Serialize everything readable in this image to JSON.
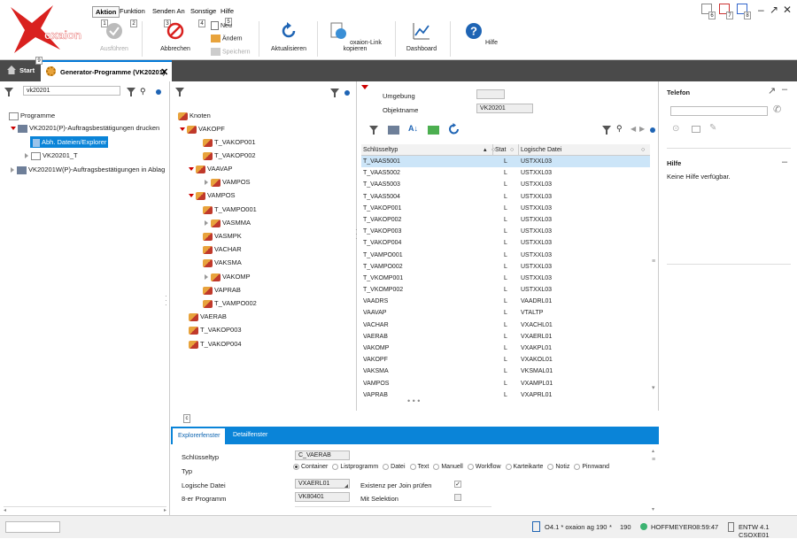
{
  "menu": {
    "items": [
      "Aktion",
      "Funktion",
      "Senden An",
      "Sonstige",
      "Hilfe"
    ],
    "shortcut_keys": [
      "1",
      "2",
      "3",
      "4",
      "5",
      "6",
      "7",
      "8",
      "9"
    ]
  },
  "brand": {
    "logo_text": "oxaion",
    "accent": "#d9211f"
  },
  "ribbon": {
    "execute": "Ausführen",
    "cancel": "Abbrechen",
    "new": "Neu",
    "change": "Ändern",
    "save": "Speichern",
    "refresh": "Aktualisieren",
    "copy_link": "oxaion-Link kopieren",
    "dashboard": "Dashboard",
    "help": "Hilfe"
  },
  "tabs": {
    "start": "Start",
    "current": "Generator-Programme (VK20201)"
  },
  "left": {
    "search_value": "vk20201",
    "root": "Programme",
    "items": [
      "VK20201(P)-Auftragsbestätigungen drucken",
      "Abh. Dateien/Explorer",
      "VK20201_T",
      "VK20201W(P)-Auftragsbestätigungen in Ablag"
    ]
  },
  "tree": {
    "root": "Knoten",
    "nodes": [
      "VAKOPF",
      "T_VAKOP001",
      "T_VAKOP002",
      "VAAVAP",
      "VAMPOS",
      "VAMPOS",
      "T_VAMPO001",
      "VASMMA",
      "VASMPK",
      "VACHAR",
      "VAKSMA",
      "VAKOMP",
      "VAPRAB",
      "T_VAMPO002",
      "VAERAB",
      "T_VAKOP003",
      "T_VAKOP004"
    ]
  },
  "env": {
    "umgebung_label": "Umgebung",
    "umgebung_value": "",
    "objektname_label": "Objektname",
    "objektname_value": "VK20201"
  },
  "grid": {
    "headers": [
      "Schlüsseltyp",
      "Stat",
      "Logische Datei"
    ],
    "rows": [
      [
        "T_VAAS5001",
        "L",
        "USTXXL03"
      ],
      [
        "T_VAAS5002",
        "L",
        "USTXXL03"
      ],
      [
        "T_VAAS5003",
        "L",
        "USTXXL03"
      ],
      [
        "T_VAAS5004",
        "L",
        "USTXXL03"
      ],
      [
        "T_VAKOP001",
        "L",
        "USTXXL03"
      ],
      [
        "T_VAKOP002",
        "L",
        "USTXXL03"
      ],
      [
        "T_VAKOP003",
        "L",
        "USTXXL03"
      ],
      [
        "T_VAKOP004",
        "L",
        "USTXXL03"
      ],
      [
        "T_VAMPO001",
        "L",
        "USTXXL03"
      ],
      [
        "T_VAMPO002",
        "L",
        "USTXXL03"
      ],
      [
        "T_VKOMP001",
        "L",
        "USTXXL03"
      ],
      [
        "T_VKOMP002",
        "L",
        "USTXXL03"
      ],
      [
        "VAADRS",
        "L",
        "VAADRL01"
      ],
      [
        "VAAVAP",
        "L",
        "VTALTP"
      ],
      [
        "VACHAR",
        "L",
        "VXACHL01"
      ],
      [
        "VAERAB",
        "L",
        "VXAERL01"
      ],
      [
        "VAKOMP",
        "L",
        "VXAKPL01"
      ],
      [
        "VAKOPF",
        "L",
        "VXAKOL01"
      ],
      [
        "VAKSMA",
        "L",
        "VKSMAL01"
      ],
      [
        "VAMPOS",
        "L",
        "VXAMPL01"
      ],
      [
        "VAPRAB",
        "L",
        "VXAPRL01"
      ]
    ]
  },
  "right": {
    "phone_title": "Telefon",
    "help_title": "Hilfe",
    "help_text": "Keine Hilfe verfügbar."
  },
  "bottom": {
    "c_marker": "c",
    "tab_explorer": "Explorerfenster",
    "tab_detail": "Detailfenster",
    "schluesseltyp_label": "Schlüsseltyp",
    "schluesseltyp_value": "C_VAERAB",
    "typ_label": "Typ",
    "typ_options": [
      "Container",
      "Listprogramm",
      "Datei",
      "Text",
      "Manuell",
      "Workflow",
      "Karteikarte",
      "Notiz",
      "Pinnwand"
    ],
    "logische_label": "Logische Datei",
    "logische_value": "VXAERL01",
    "achter_label": "8-er Programm",
    "achter_value": "VK80401",
    "existenz_label": "Existenz per Join prüfen",
    "selektion_label": "Mit Selektion"
  },
  "status": {
    "system": "O4.1 * oxaion ag 190",
    "star": "*",
    "count": "190",
    "user": "HOFFMEYER",
    "time": "08:59:47",
    "env": "ENTW 4.1 CSOXE01"
  }
}
